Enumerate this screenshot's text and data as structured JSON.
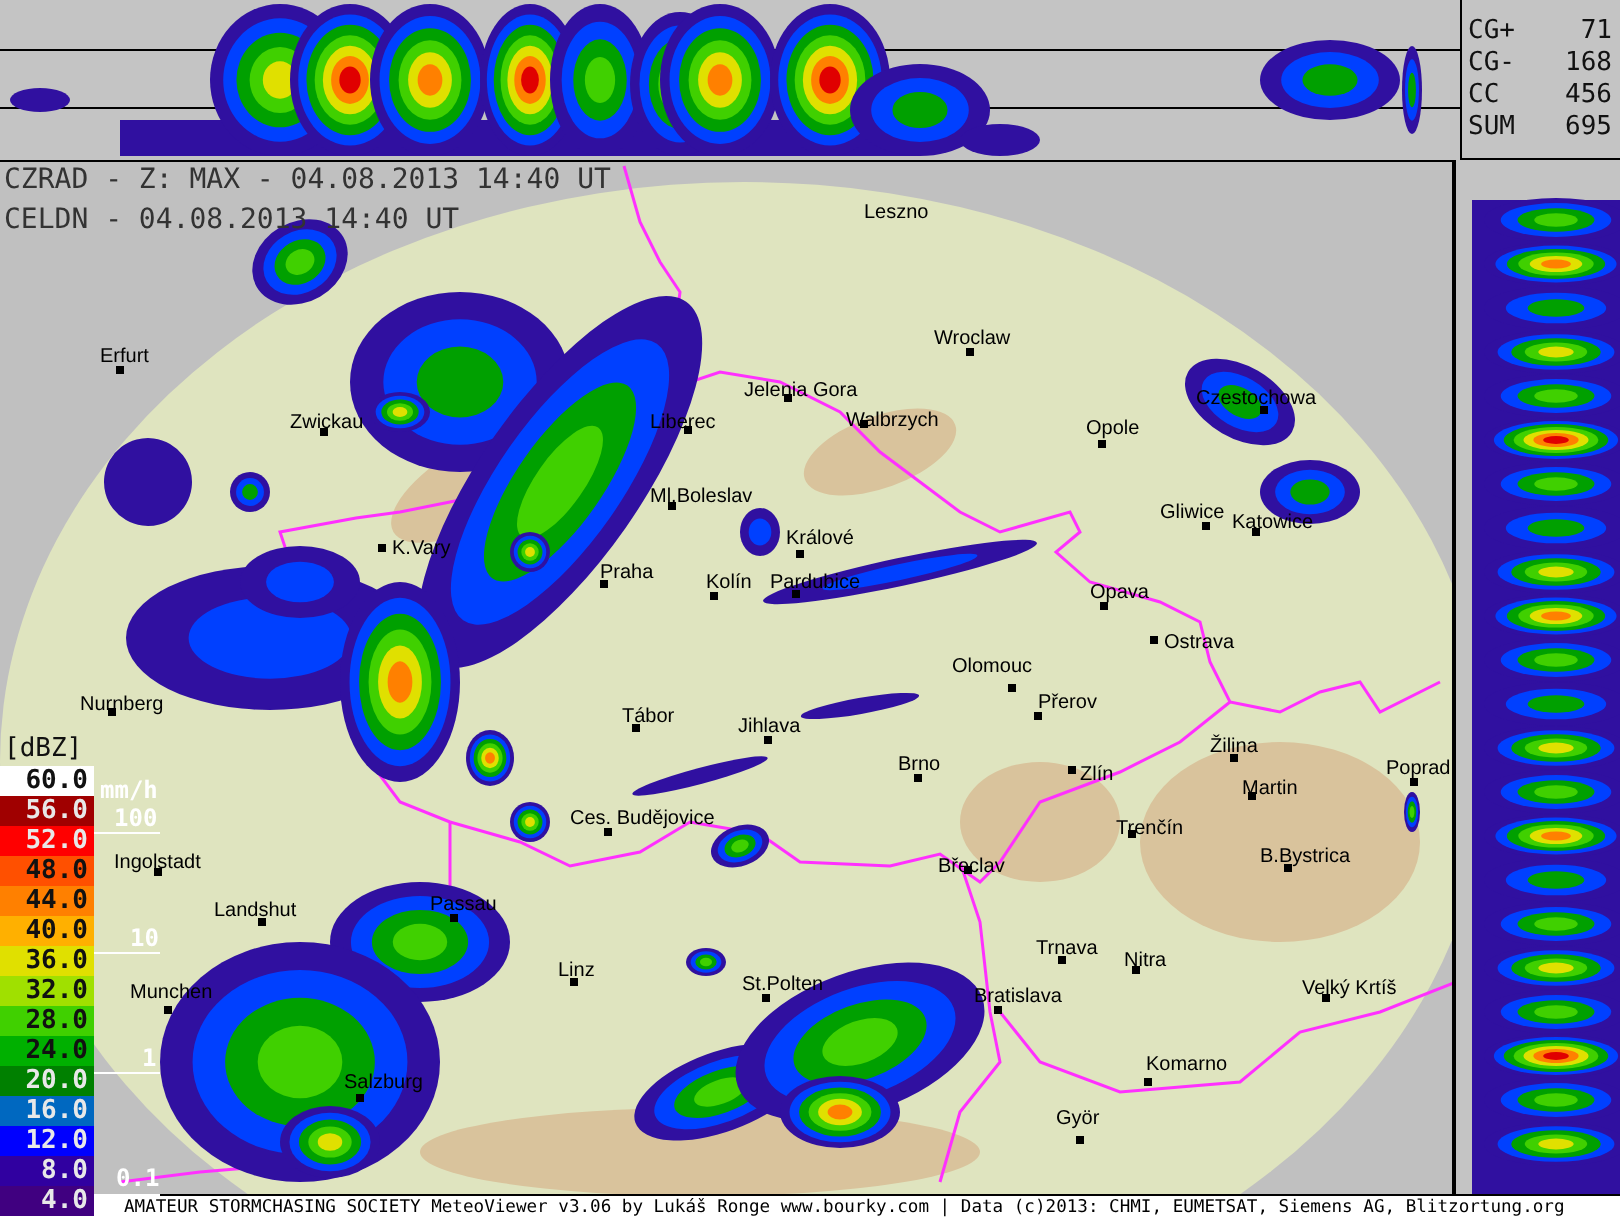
{
  "lightning_stats": [
    {
      "label": "CG+",
      "value": "71"
    },
    {
      "label": "CG-",
      "value": "168"
    },
    {
      "label": "CC",
      "value": "456"
    },
    {
      "label": "SUM",
      "value": "695"
    }
  ],
  "map": {
    "headers": [
      "CZRAD - Z: MAX - 04.08.2013 14:40 UT",
      "CELDN - 04.08.2013 14:40 UT"
    ],
    "cities": [
      {
        "name": "Leszno",
        "marker": false
      },
      {
        "name": "Wroclaw",
        "marker": true
      },
      {
        "name": "Erfurt",
        "marker": true
      },
      {
        "name": "Jelenia Gora",
        "marker": true
      },
      {
        "name": "Walbrzych",
        "marker": true
      },
      {
        "name": "Opole",
        "marker": true
      },
      {
        "name": "Czestochowa",
        "marker": true
      },
      {
        "name": "Zwickau",
        "marker": true
      },
      {
        "name": "Liberec",
        "marker": true
      },
      {
        "name": "Ml.Boleslav",
        "marker": true
      },
      {
        "name": "Gliwice",
        "marker": true
      },
      {
        "name": "Katowice",
        "marker": true
      },
      {
        "name": "K.Vary",
        "marker": true
      },
      {
        "name": "Králové",
        "marker": true
      },
      {
        "name": "Praha",
        "marker": true
      },
      {
        "name": "Kolín",
        "marker": true
      },
      {
        "name": "Pardubice",
        "marker": true
      },
      {
        "name": "Opava",
        "marker": true
      },
      {
        "name": "Ostrava",
        "marker": true
      },
      {
        "name": "Olomouc",
        "marker": true
      },
      {
        "name": "Nurnberg",
        "marker": true
      },
      {
        "name": "Přerov",
        "marker": true
      },
      {
        "name": "Tábor",
        "marker": true
      },
      {
        "name": "Jihlava",
        "marker": true
      },
      {
        "name": "Žilina",
        "marker": true
      },
      {
        "name": "Brno",
        "marker": true
      },
      {
        "name": "Zlín",
        "marker": true
      },
      {
        "name": "Martin",
        "marker": true
      },
      {
        "name": "Poprad",
        "marker": true
      },
      {
        "name": "Ces. Budějovice",
        "marker": true
      },
      {
        "name": "Trenčín",
        "marker": true
      },
      {
        "name": "Ingolstadt",
        "marker": true
      },
      {
        "name": "Břeclav",
        "marker": true
      },
      {
        "name": "B.Bystrica",
        "marker": true
      },
      {
        "name": "Landshut",
        "marker": true
      },
      {
        "name": "Passau",
        "marker": true
      },
      {
        "name": "Trnava",
        "marker": true
      },
      {
        "name": "Nitra",
        "marker": true
      },
      {
        "name": "Munchen",
        "marker": true
      },
      {
        "name": "Linz",
        "marker": true
      },
      {
        "name": "St.Polten",
        "marker": true
      },
      {
        "name": "Bratislava",
        "marker": true
      },
      {
        "name": "Velký Krtíš",
        "marker": true
      },
      {
        "name": "Salzburg",
        "marker": true
      },
      {
        "name": "Komarno",
        "marker": true
      },
      {
        "name": "Györ",
        "marker": true
      }
    ]
  },
  "legend": {
    "unit": "[dBZ]",
    "levels": [
      {
        "value": "60.0",
        "color": "#ffffff"
      },
      {
        "value": "56.0",
        "color": "#a00000"
      },
      {
        "value": "52.0",
        "color": "#ff0000"
      },
      {
        "value": "48.0",
        "color": "#ff5000"
      },
      {
        "value": "44.0",
        "color": "#ff8000"
      },
      {
        "value": "40.0",
        "color": "#ffb000"
      },
      {
        "value": "36.0",
        "color": "#e0e000"
      },
      {
        "value": "32.0",
        "color": "#a0e000"
      },
      {
        "value": "28.0",
        "color": "#40d000"
      },
      {
        "value": "24.0",
        "color": "#00b000"
      },
      {
        "value": "20.0",
        "color": "#008000"
      },
      {
        "value": "16.0",
        "color": "#0068c0"
      },
      {
        "value": "12.0",
        "color": "#0000ff"
      },
      {
        "value": "8.0",
        "color": "#3000a0"
      },
      {
        "value": "4.0",
        "color": "#400080"
      }
    ],
    "rain_unit": "mm/h",
    "rain_marks": [
      "100",
      "10",
      "1",
      "0.1"
    ]
  },
  "footer": "AMATEUR STORMCHASING SOCIETY MeteoViewer v3.06 by Lukáš Ronge www.bourky.com | Data (c)2013: CHMI, EUMETSAT, Siemens AG, Blitzortung.org"
}
